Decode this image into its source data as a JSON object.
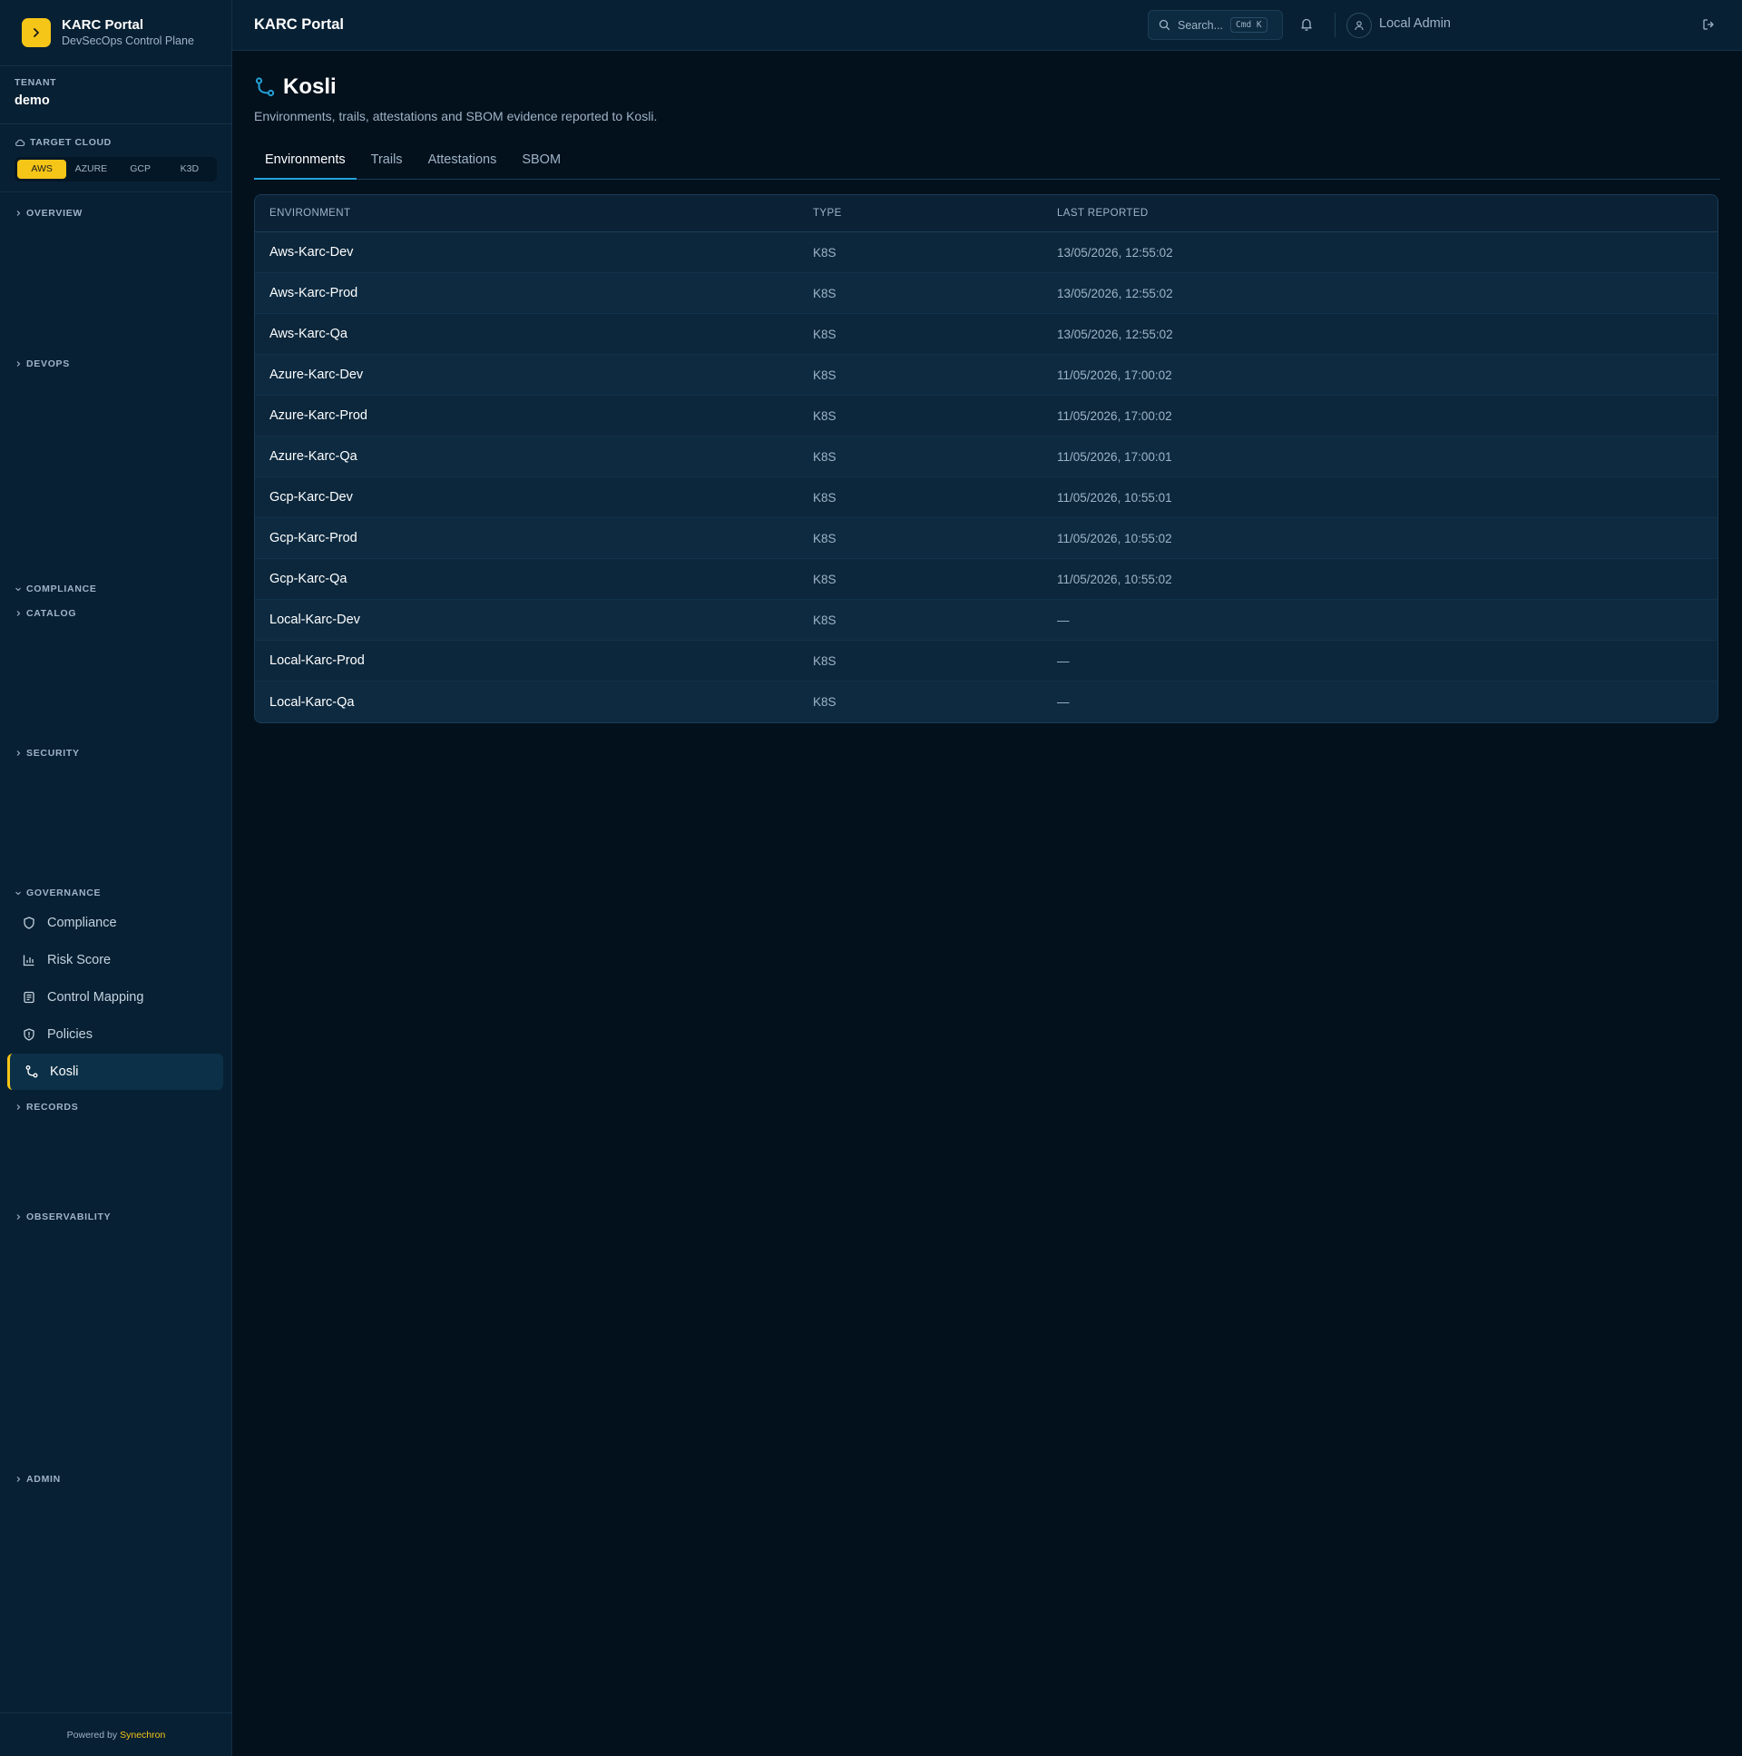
{
  "sidebar": {
    "brand_title": "KARC Portal",
    "brand_subtitle": "DevSecOps Control Plane",
    "tenant_label": "TENANT",
    "tenant_value": "demo",
    "target_cloud_label": "TARGET CLOUD",
    "clouds": [
      "AWS",
      "AZURE",
      "GCP",
      "K3D"
    ],
    "active_cloud": "AWS",
    "sections": {
      "overview": "OVERVIEW",
      "devops": "DEVOPS",
      "compliance": "COMPLIANCE",
      "catalog": "CATALOG",
      "security": "SECURITY",
      "governance": "GOVERNANCE",
      "records": "RECORDS",
      "observability": "OBSERVABILITY",
      "admin": "ADMIN"
    },
    "governance_items": [
      "Compliance",
      "Risk Score",
      "Control Mapping",
      "Policies",
      "Kosli"
    ],
    "active_item": "Kosli",
    "footer_prefix": "Powered by",
    "footer_brand": "Synechron"
  },
  "topbar": {
    "title": "KARC Portal",
    "search_placeholder": "Search...",
    "search_shortcut": "Cmd K",
    "user_name": "Local Admin"
  },
  "page": {
    "title": "Kosli",
    "description": "Environments, trails, attestations and SBOM evidence reported to Kosli.",
    "tabs": [
      "Environments",
      "Trails",
      "Attestations",
      "SBOM"
    ],
    "active_tab": "Environments"
  },
  "table": {
    "columns": [
      "ENVIRONMENT",
      "TYPE",
      "LAST REPORTED"
    ],
    "rows": [
      {
        "environment": "Aws-Karc-Dev",
        "type": "K8S",
        "last_reported": "13/05/2026, 12:55:02"
      },
      {
        "environment": "Aws-Karc-Prod",
        "type": "K8S",
        "last_reported": "13/05/2026, 12:55:02"
      },
      {
        "environment": "Aws-Karc-Qa",
        "type": "K8S",
        "last_reported": "13/05/2026, 12:55:02"
      },
      {
        "environment": "Azure-Karc-Dev",
        "type": "K8S",
        "last_reported": "11/05/2026, 17:00:02"
      },
      {
        "environment": "Azure-Karc-Prod",
        "type": "K8S",
        "last_reported": "11/05/2026, 17:00:02"
      },
      {
        "environment": "Azure-Karc-Qa",
        "type": "K8S",
        "last_reported": "11/05/2026, 17:00:01"
      },
      {
        "environment": "Gcp-Karc-Dev",
        "type": "K8S",
        "last_reported": "11/05/2026, 10:55:01"
      },
      {
        "environment": "Gcp-Karc-Prod",
        "type": "K8S",
        "last_reported": "11/05/2026, 10:55:02"
      },
      {
        "environment": "Gcp-Karc-Qa",
        "type": "K8S",
        "last_reported": "11/05/2026, 10:55:02"
      },
      {
        "environment": "Local-Karc-Dev",
        "type": "K8S",
        "last_reported": "—"
      },
      {
        "environment": "Local-Karc-Prod",
        "type": "K8S",
        "last_reported": "—"
      },
      {
        "environment": "Local-Karc-Qa",
        "type": "K8S",
        "last_reported": "—"
      }
    ]
  },
  "colors": {
    "accent": "#f5c518",
    "tab_underline": "#22a3d9",
    "background": "#03111d",
    "sidebar": "#082033"
  },
  "icons": {
    "brand": "chevron-right-icon",
    "page": "git-branch-icon",
    "search": "search-icon",
    "notifications": "bell-icon",
    "user": "user-icon",
    "logout": "logout-icon"
  }
}
